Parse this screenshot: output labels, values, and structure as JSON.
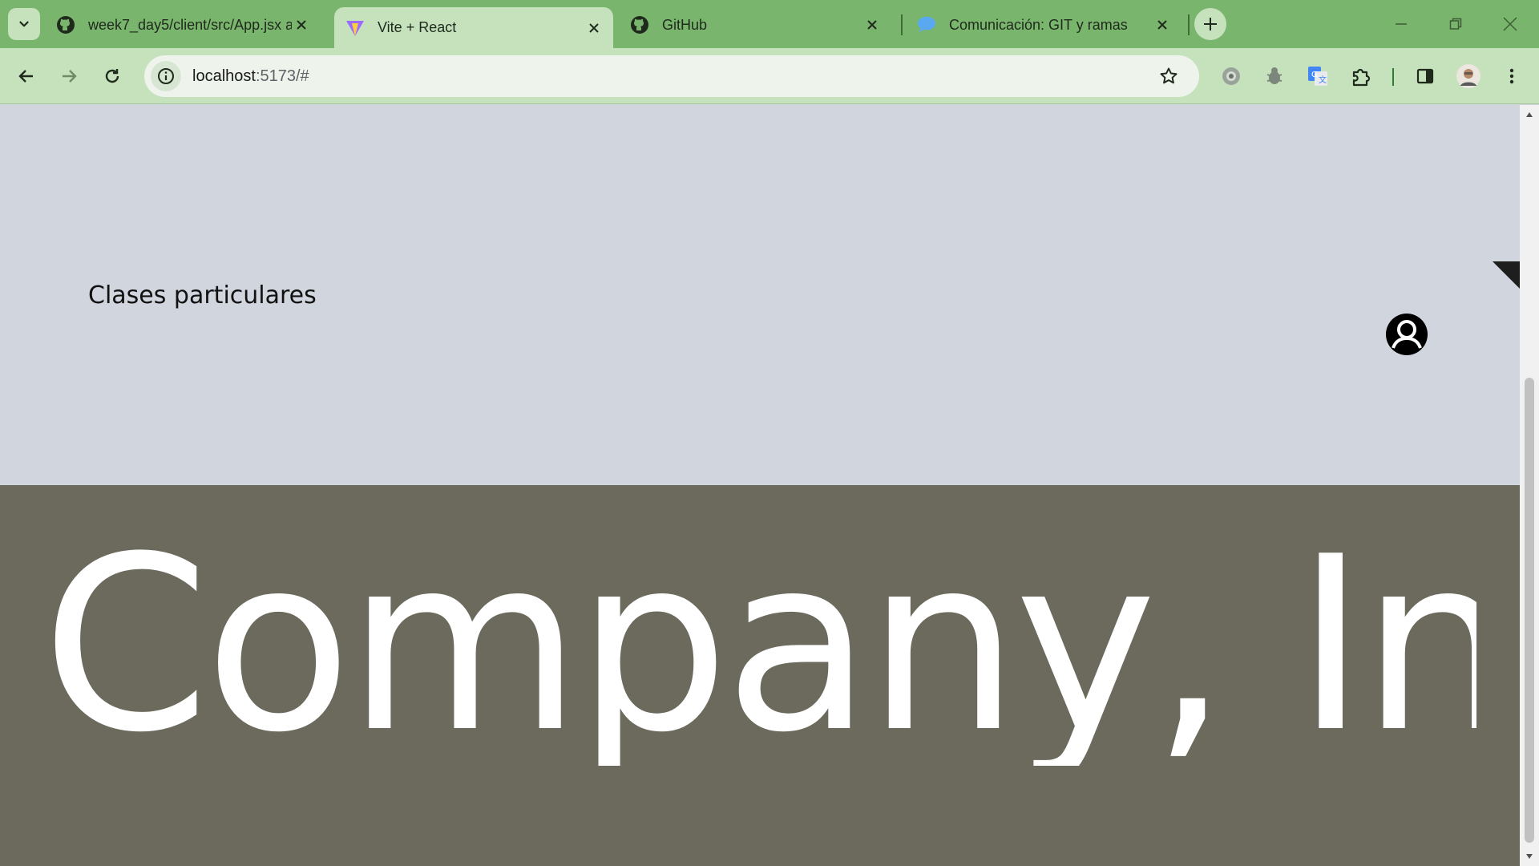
{
  "browser": {
    "tabs": [
      {
        "title": "week7_day5/client/src/App.jsx a",
        "icon": "github-icon",
        "active": false
      },
      {
        "title": "Vite + React",
        "icon": "vite-icon",
        "active": true
      },
      {
        "title": "GitHub",
        "icon": "github-icon",
        "active": false
      },
      {
        "title": "Comunicación: GIT y ramas",
        "icon": "chat-bubble-icon",
        "active": false
      }
    ],
    "url_host": "localhost",
    "url_rest": ":5173/#",
    "colors": {
      "tabstrip": "#7ab56e",
      "toolbar": "#c6e2bd"
    }
  },
  "page": {
    "brand": "Clases particulares",
    "footer_text": "Company, Inc",
    "colors": {
      "hero_bg": "#d1d5de",
      "footer_bg": "#6b6a5c",
      "footer_text": "#ffffff"
    }
  }
}
